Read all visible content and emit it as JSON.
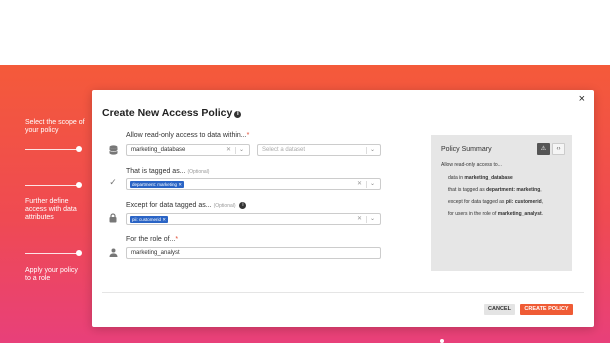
{
  "annotations": [
    "Select the scope of your policy",
    "Further define access with data attributes",
    "Apply your policy to a role"
  ],
  "modal": {
    "title": "Create New Access Policy",
    "close_glyph": "×"
  },
  "scope": {
    "label": "Allow read-only access to data within...",
    "required_mark": "*",
    "database_value": "marketing_database",
    "dataset_placeholder": "Select a dataset"
  },
  "tagged": {
    "label": "That is tagged as...",
    "optional": "(Optional)",
    "tags": [
      "department: marketing"
    ]
  },
  "except": {
    "label": "Except for data tagged as...",
    "optional": "(Optional)",
    "tags": [
      "pii: customerid"
    ]
  },
  "role": {
    "label": "For the role of...",
    "required_mark": "*",
    "value": "marketing_analyst"
  },
  "summary": {
    "title": "Policy Summary",
    "intro": "Allow read-only access to...",
    "lines": [
      {
        "prefix": "data in ",
        "bold": "marketing_database"
      },
      {
        "prefix": "that is tagged as ",
        "bold": "department: marketing",
        "suffix": ","
      },
      {
        "prefix": "except for data tagged as ",
        "bold": "pii: customerid",
        "suffix": ","
      },
      {
        "prefix": "for users in the role of ",
        "bold": "marketing_analyst",
        "suffix": "."
      }
    ]
  },
  "footer": {
    "cancel": "CANCEL",
    "create": "CREATE POLICY"
  },
  "colors": {
    "accent": "#ef5b35",
    "tag": "#2a64c5"
  },
  "icons": {
    "scope": "database-icon",
    "tagged": "check-icon",
    "except": "lock-icon",
    "role": "user-icon",
    "summary_warn": "warning-icon",
    "summary_code": "code-icon"
  }
}
